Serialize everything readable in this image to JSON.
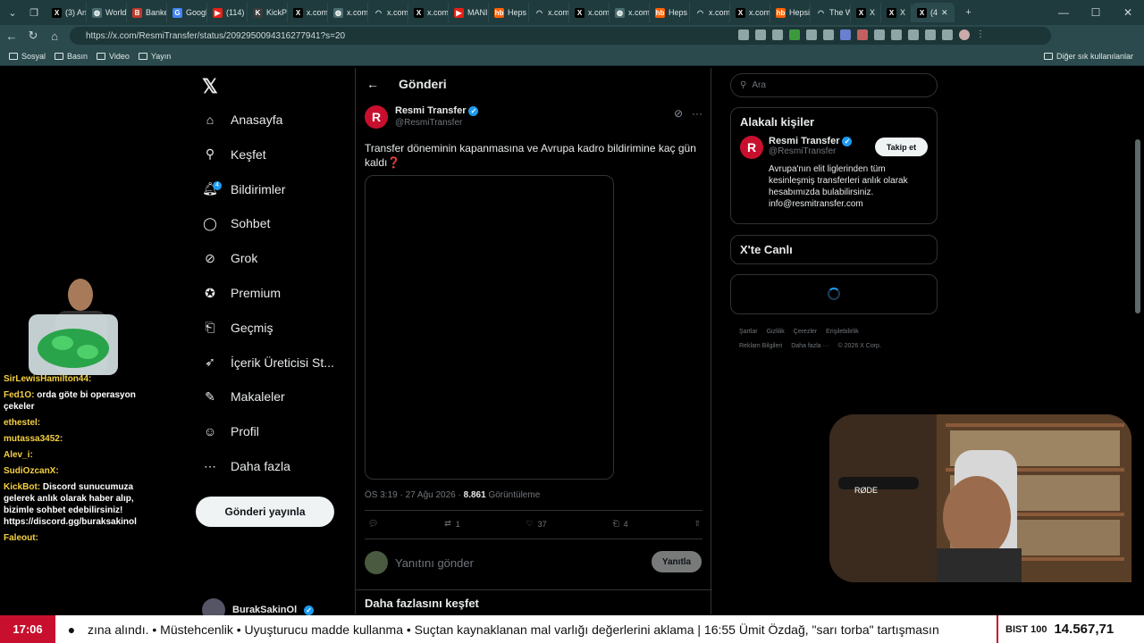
{
  "browser": {
    "tabs": [
      {
        "label": "(3) An",
        "icon": "x-icon"
      },
      {
        "label": "World",
        "icon": "globe-icon"
      },
      {
        "label": "Banke",
        "icon": "b-icon"
      },
      {
        "label": "Googl",
        "icon": "google-icon"
      },
      {
        "label": "(114)",
        "icon": "youtube-icon"
      },
      {
        "label": "KickPe",
        "icon": "kick-icon"
      },
      {
        "label": "x.com",
        "icon": "x-icon"
      },
      {
        "label": "x.com",
        "icon": "globe-icon"
      },
      {
        "label": "x.com",
        "icon": "loading-icon"
      },
      {
        "label": "x.com",
        "icon": "x-icon"
      },
      {
        "label": "MANI",
        "icon": "youtube-icon"
      },
      {
        "label": "Heps",
        "icon": "hb-icon"
      },
      {
        "label": "x.com",
        "icon": "loading-icon"
      },
      {
        "label": "x.com",
        "icon": "x-icon"
      },
      {
        "label": "x.com",
        "icon": "globe-icon"
      },
      {
        "label": "Heps",
        "icon": "hb-icon"
      },
      {
        "label": "x.com",
        "icon": "loading-icon"
      },
      {
        "label": "x.com",
        "icon": "x-icon"
      },
      {
        "label": "Hepsi",
        "icon": "hb-icon"
      },
      {
        "label": "The W",
        "icon": "loading-icon"
      },
      {
        "label": "X",
        "icon": "x-icon"
      },
      {
        "label": "X",
        "icon": "x-icon"
      },
      {
        "label": "(4",
        "icon": "x-icon",
        "active": true
      }
    ],
    "url": "https://x.com/ResmiTransfer/status/2092950094316277941?s=20",
    "bookmarks": [
      "Sosyal",
      "Basın",
      "Video",
      "Yayın"
    ],
    "bookmarks_right": "Diğer sık kullanılanlar"
  },
  "nav": {
    "items": [
      {
        "label": "Anasayfa",
        "icon": "home-icon"
      },
      {
        "label": "Keşfet",
        "icon": "search-icon"
      },
      {
        "label": "Bildirimler",
        "icon": "bell-icon",
        "badge": "4"
      },
      {
        "label": "Sohbet",
        "icon": "chat-icon"
      },
      {
        "label": "Grok",
        "icon": "grok-icon"
      },
      {
        "label": "Premium",
        "icon": "premium-icon"
      },
      {
        "label": "Geçmiş",
        "icon": "bookmark-icon"
      },
      {
        "label": "İçerik Üreticisi St...",
        "icon": "rocket-icon"
      },
      {
        "label": "Makaleler",
        "icon": "article-icon"
      },
      {
        "label": "Profil",
        "icon": "profile-icon"
      },
      {
        "label": "Daha fazla",
        "icon": "more-icon"
      }
    ],
    "post_button": "Gönderi yayınla",
    "user_name": "BurakSakinOl"
  },
  "main": {
    "header_title": "Gönderi",
    "tweet": {
      "author_name": "Resmi Transfer",
      "author_handle": "@ResmiTransfer",
      "avatar_letter": "R",
      "text": "Transfer döneminin kapanmasına ve Avrupa kadro bildirimine kaç gün kaldı❓",
      "time": "ÖS 3:19 · 27 Ağu 2026 · ",
      "views": "8.861",
      "views_label": " Görüntüleme",
      "retweets": "1",
      "likes": "37",
      "bookmarks": "4"
    },
    "reply_placeholder": "Yanıtını gönder",
    "reply_button": "Yanıtla",
    "explore_more": "Daha fazlasını keşfet"
  },
  "right": {
    "search_placeholder": "Ara",
    "relevant_title": "Alakalı kişiler",
    "person": {
      "name": "Resmi Transfer",
      "handle": "@ResmiTransfer",
      "bio": "Avrupa'nın elit liglerinden tüm kesinleşmiş transferleri anlık olarak hesabımızda bulabilirsiniz. info@resmitransfer.com",
      "follow_button": "Takip et"
    },
    "live_title": "X'te Canlı",
    "footer": [
      "Şartlar",
      "Gizlilik",
      "Çerezler",
      "Erişilebilirlik",
      "Reklam Bilgileri",
      "Daha fazla ···",
      "© 2026 X Corp."
    ]
  },
  "stream": {
    "chat": [
      {
        "user": "SirLewisHamilton44:",
        "msg": ""
      },
      {
        "user": "Fed1O:",
        "msg": "orda göte bi operasyon çekeler"
      },
      {
        "user": "ethestel:",
        "msg": ""
      },
      {
        "user": "mutassa3452:",
        "msg": ""
      },
      {
        "user": "Alev_i:",
        "msg": ""
      },
      {
        "user": "SudiOzcanX:",
        "msg": ""
      },
      {
        "user": "KickBot:",
        "msg": "Discord sunucumuza gelerek anlık olarak haber alıp, bizimle sohbet edebilirsiniz! https://discord.gg/buraksakinol"
      },
      {
        "user": "Faleout:",
        "msg": ""
      }
    ],
    "ticker_time": "17:06",
    "ticker_text": "zına alındı. • Müstehcenlik • Uyuşturucu madde kullanma • Suçtan kaynaklanan mal varlığı değerlerini aklama   |   16:55  Ümit Özdağ, \"sarı torba\" tartışmasın",
    "bist_label": "BIST 100",
    "bist_value": "14.567,71"
  },
  "colors": {
    "accent": "#1d9bf0",
    "brand_red": "#c8102e",
    "chrome": "#1f3b3e"
  }
}
